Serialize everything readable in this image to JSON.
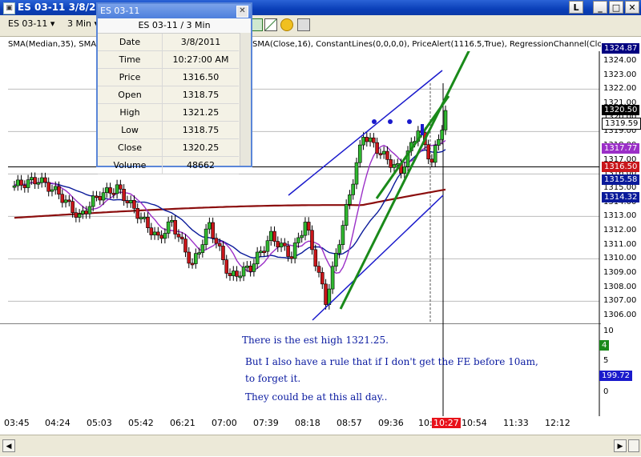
{
  "window": {
    "title": "ES 03-11  3/8/2"
  },
  "toolbar": {
    "instrument": "ES 03-11",
    "interval": "3 Min"
  },
  "indicators": {
    "left": "SMA(Median,35), SMA",
    "right": "SMA(Close,16), ConstantLines(0,0,0,0), PriceAlert(1116.5,True), RegressionChannel(Clo"
  },
  "data_box": {
    "title": "ES 03-11",
    "subtitle": "ES 03-11 / 3 Min",
    "rows": [
      {
        "label": "Date",
        "value": "3/8/2011"
      },
      {
        "label": "Time",
        "value": "10:27:00 AM"
      },
      {
        "label": "Price",
        "value": "1316.50"
      },
      {
        "label": "Open",
        "value": "1318.75"
      },
      {
        "label": "High",
        "value": "1321.25"
      },
      {
        "label": "Low",
        "value": "1318.75"
      },
      {
        "label": "Close",
        "value": "1320.25"
      },
      {
        "label": "Volume",
        "value": "48662"
      }
    ]
  },
  "price_axis": {
    "ticks": [
      "1324.00",
      "1323.00",
      "1322.00",
      "1321.00",
      "1320.00",
      "1319.00",
      "1318.00",
      "1317.00",
      "1316.00",
      "1315.00",
      "1314.00",
      "1313.00",
      "1312.00",
      "1311.00",
      "1310.00",
      "1309.00",
      "1308.00",
      "1307.00",
      "1306.00"
    ],
    "badges": {
      "top": "1324.87",
      "last": "1320.50",
      "ref": "1319.59",
      "sma_fast": "1317.77",
      "current": "1316.50",
      "sma_mid": "1315.58",
      "sma_slow": "1314.32"
    }
  },
  "volume_axis": {
    "ticks": [
      "10",
      "5",
      "0"
    ],
    "badge_small": "4",
    "badge_volume": "199.72"
  },
  "time_axis": {
    "labels": [
      "03:45",
      "04:24",
      "05:03",
      "05:42",
      "06:21",
      "07:00",
      "07:39",
      "08:18",
      "08:57",
      "09:36",
      "10:",
      "10:54",
      "11:33",
      "12:12"
    ],
    "cursor": "10:27"
  },
  "notes": [
    "There is the est high 1321.25.",
    "But I also have a rule that if I don't get the FE before 10am,",
    "to forget it.",
    "They could be at this all day.."
  ],
  "colors": {
    "up": "#2fb82f",
    "down": "#c8161a",
    "sma_slow": "#8b0d0d",
    "sma_mid": "#0a1a9a",
    "sma_fast": "#9b2fc7",
    "trendline": "#1a8a1a",
    "channel": "#1a1acc"
  }
}
